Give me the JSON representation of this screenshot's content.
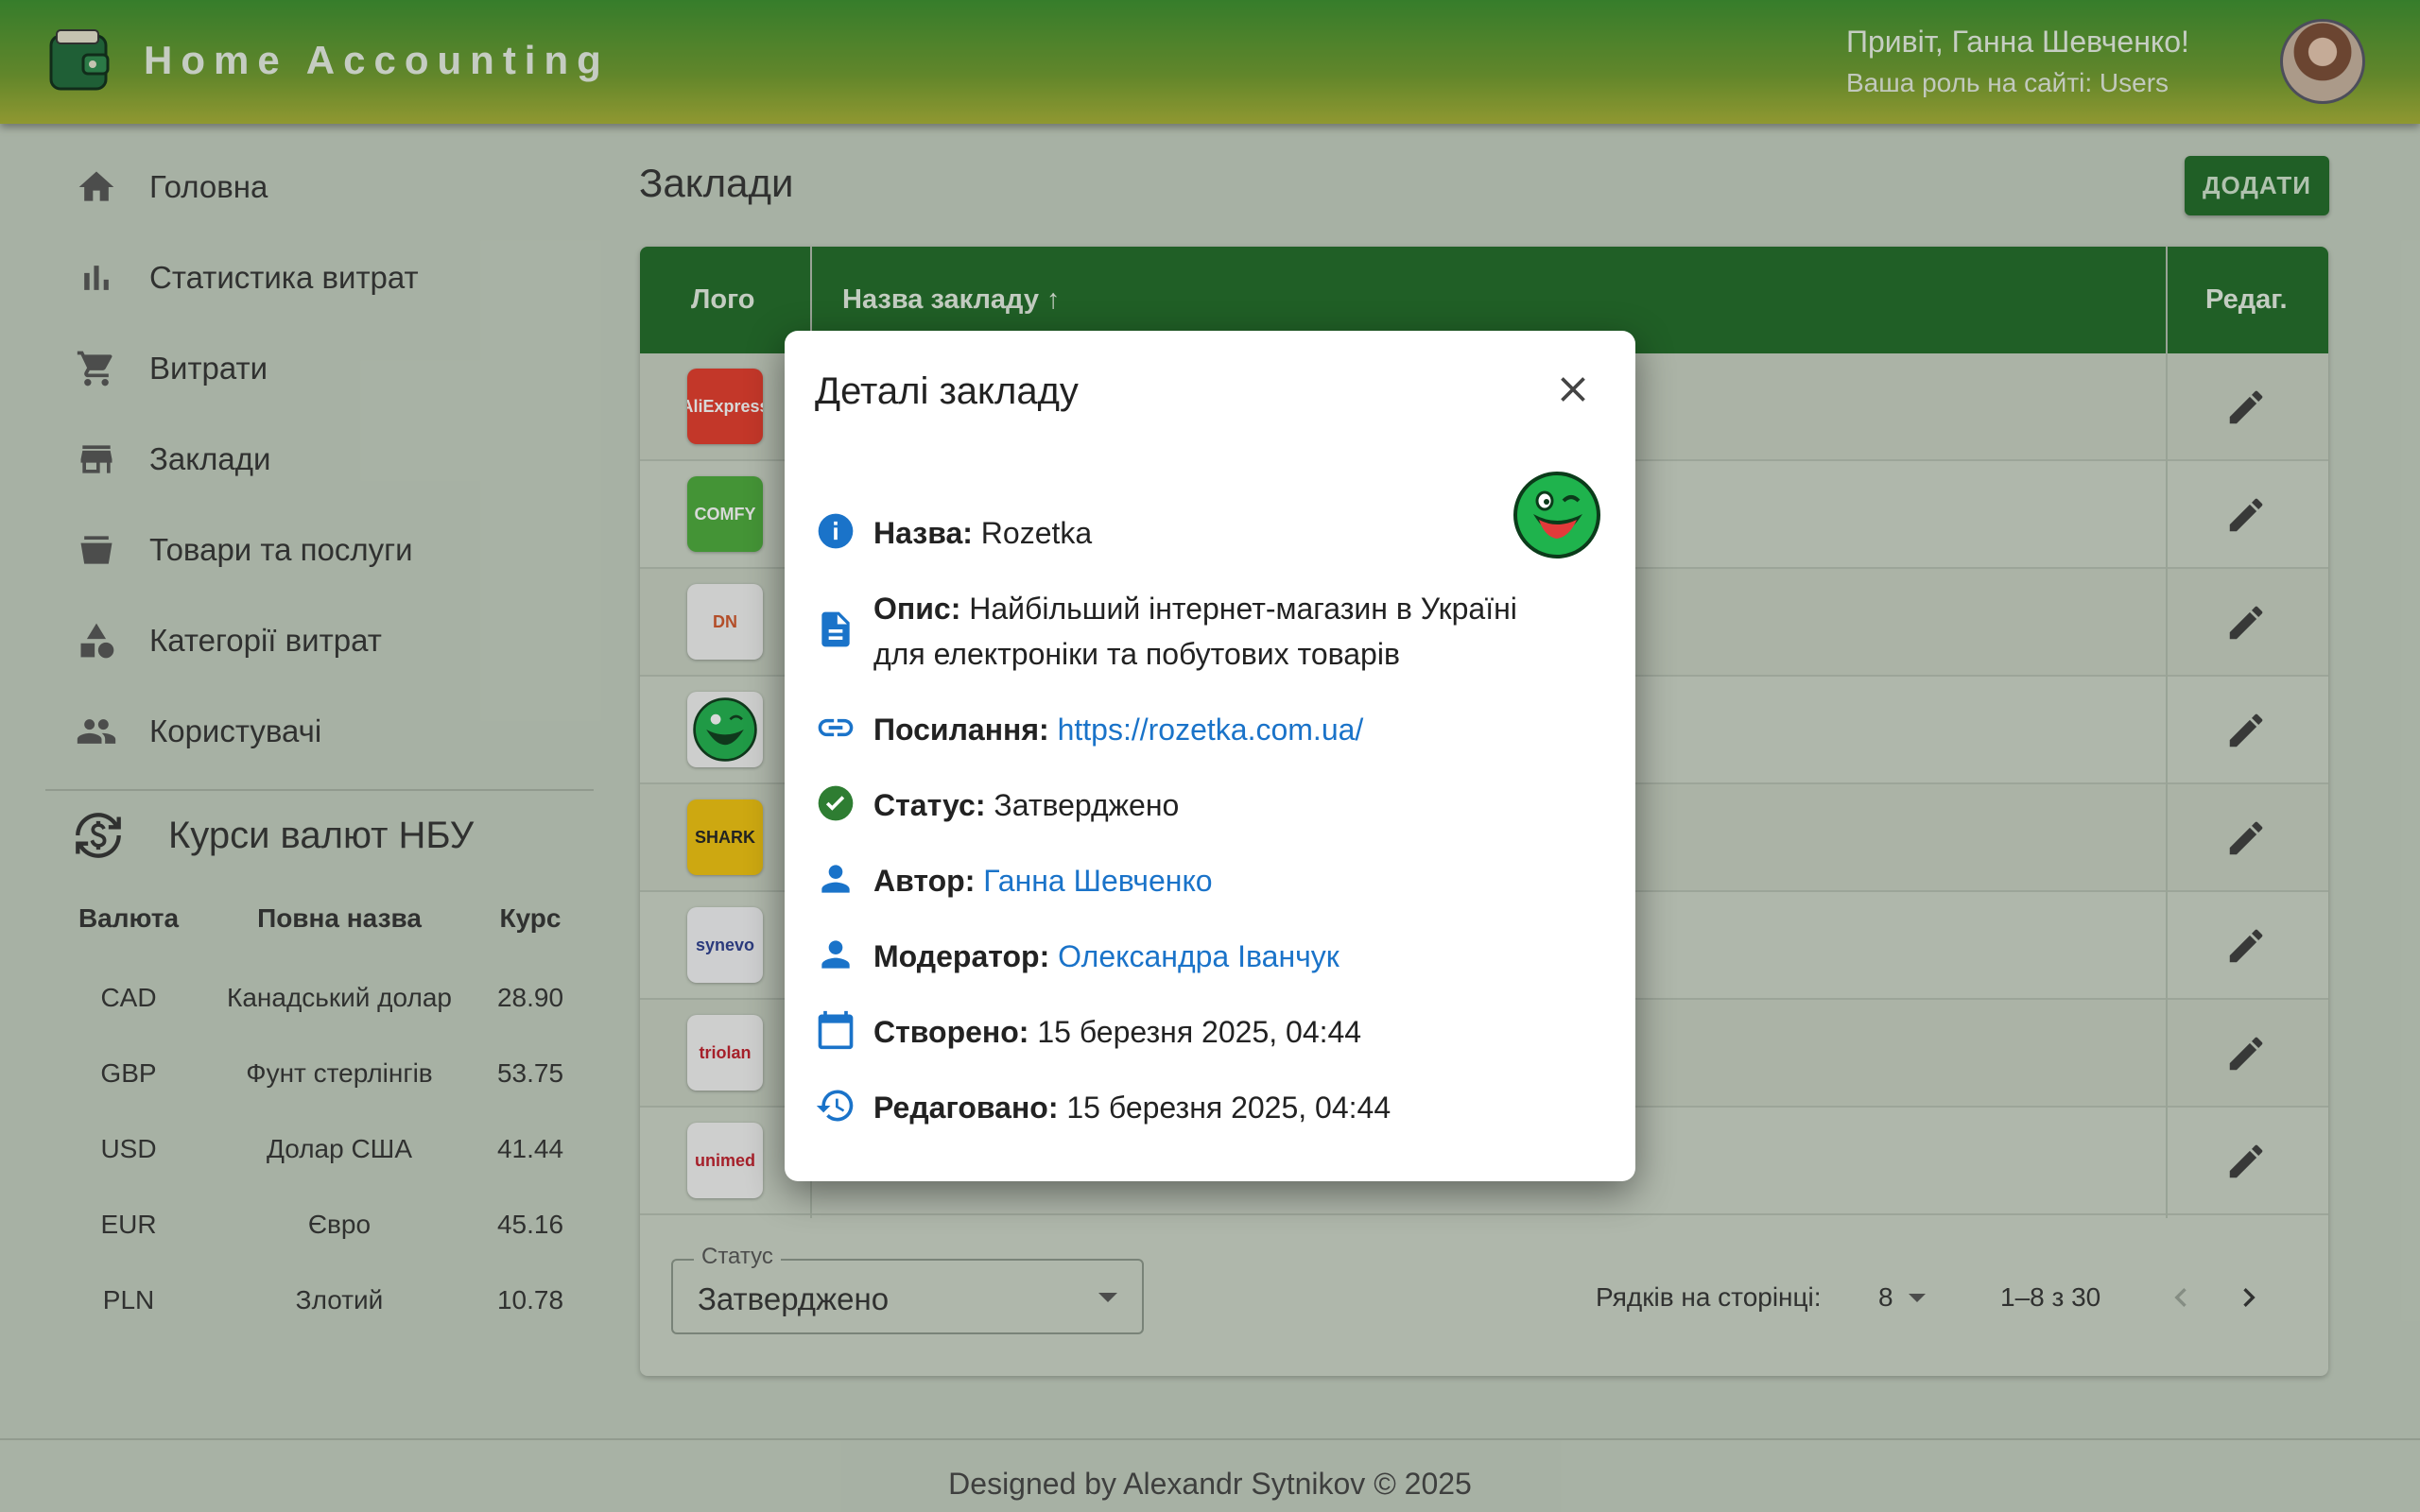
{
  "header": {
    "app_title": "Home Accounting",
    "greeting": "Привіт, Ганна Шевченко!",
    "role": "Ваша роль на сайті: Users"
  },
  "sidebar": {
    "items": [
      {
        "label": "Головна",
        "icon": "home-icon"
      },
      {
        "label": "Статистика витрат",
        "icon": "bar-chart-icon"
      },
      {
        "label": "Витрати",
        "icon": "cart-icon"
      },
      {
        "label": "Заклади",
        "icon": "store-icon"
      },
      {
        "label": "Товари та послуги",
        "icon": "basket-icon"
      },
      {
        "label": "Категорії витрат",
        "icon": "category-icon"
      },
      {
        "label": "Користувачі",
        "icon": "users-icon"
      }
    ],
    "rates": {
      "title": "Курси валют НБУ",
      "headers": [
        "Валюта",
        "Повна назва",
        "Курс"
      ],
      "rows": [
        {
          "code": "CAD",
          "name": "Канадський долар",
          "rate": "28.90"
        },
        {
          "code": "GBP",
          "name": "Фунт стерлінгів",
          "rate": "53.75"
        },
        {
          "code": "USD",
          "name": "Долар США",
          "rate": "41.44"
        },
        {
          "code": "EUR",
          "name": "Євро",
          "rate": "45.16"
        },
        {
          "code": "PLN",
          "name": "Злотий",
          "rate": "10.78"
        }
      ]
    }
  },
  "main": {
    "title": "Заклади",
    "add_label": "ДОДАТИ",
    "table": {
      "headers": {
        "logo": "Лого",
        "name": "Назва закладу ↑",
        "edit": "Редаг."
      },
      "row_logos": [
        {
          "name": "aliexpress",
          "text": "AliExpress",
          "bg": "#e63a2a",
          "fg": "#ffffff"
        },
        {
          "name": "comfy",
          "text": "COMFY",
          "bg": "#4bab3a",
          "fg": "#ffffff"
        },
        {
          "name": "dn",
          "text": "DN",
          "bg": "#f2f2f2",
          "fg": "#d2562a"
        },
        {
          "name": "rozetka",
          "text": "",
          "bg": "#f2f2f2",
          "fg": "#000000"
        },
        {
          "name": "shark",
          "text": "SHARK",
          "bg": "#f2c40d",
          "fg": "#222222"
        },
        {
          "name": "synevo",
          "text": "synevo",
          "bg": "#f3f3f6",
          "fg": "#2c3e8f"
        },
        {
          "name": "triolan",
          "text": "triolan",
          "bg": "#f3f3f3",
          "fg": "#c21e2b"
        },
        {
          "name": "unimed",
          "text": "unimed",
          "bg": "#f3f3f3",
          "fg": "#c21e2b"
        }
      ]
    },
    "status": {
      "label": "Статус",
      "value": "Затверджено"
    },
    "pager": {
      "rows_label": "Рядків на сторінці:",
      "rows_value": "8",
      "range": "1–8 з 30"
    }
  },
  "modal": {
    "title": "Деталі закладу",
    "fields": [
      {
        "label": "Назва:",
        "value": "Rozetka",
        "link": false,
        "icon": "info-icon"
      },
      {
        "label": "Опис:",
        "value": "Найбільший інтернет-магазин в Україні для електроніки та побутових товарів",
        "link": false,
        "icon": "document-icon"
      },
      {
        "label": "Посилання:",
        "value": "https://rozetka.com.ua/",
        "link": true,
        "icon": "link-icon"
      },
      {
        "label": "Статус:",
        "value": "Затверджено",
        "link": false,
        "icon": "check-circle-icon"
      },
      {
        "label": "Автор:",
        "value": "Ганна Шевченко",
        "link": true,
        "icon": "person-icon"
      },
      {
        "label": "Модератор:",
        "value": "Олександра Іванчук",
        "link": true,
        "icon": "person-icon"
      },
      {
        "label": "Створено:",
        "value": "15 березня 2025, 04:44",
        "link": false,
        "icon": "calendar-icon"
      },
      {
        "label": "Редаговано:",
        "value": "15 березня 2025, 04:44",
        "link": false,
        "icon": "history-icon"
      }
    ]
  },
  "footer": {
    "text": "Designed by Alexandr Sytnikov © 2025"
  },
  "colors": {
    "primary": "#1f6b26",
    "link": "#1a73c9",
    "success": "#2e7d32"
  }
}
